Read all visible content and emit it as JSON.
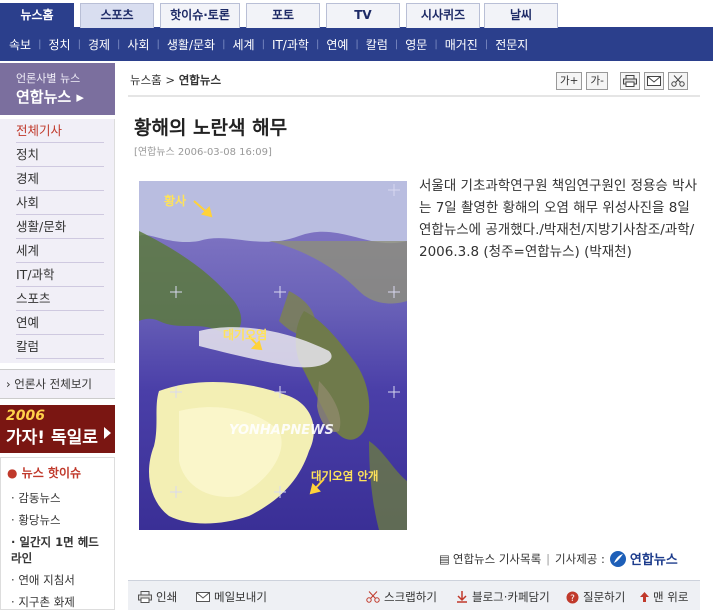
{
  "top_tabs": [
    "뉴스홈",
    "스포츠",
    "핫이슈·토론",
    "포토",
    "TV",
    "시사퀴즈",
    "날씨"
  ],
  "categories": [
    "속보",
    "정치",
    "경제",
    "사회",
    "생활/문화",
    "세계",
    "IT/과학",
    "연예",
    "칼럼",
    "영문",
    "매거진",
    "전문지"
  ],
  "sidebar": {
    "press_small": "언론사별 뉴스",
    "press_name": "연합뉴스",
    "items": [
      "전체기사",
      "정치",
      "경제",
      "사회",
      "생활/문화",
      "세계",
      "IT/과학",
      "스포츠",
      "연예",
      "칼럼"
    ],
    "all_press": "언론사 전체보기",
    "banner_year": "2006",
    "banner_text": "가자! 독일로",
    "issue_title": "뉴스 핫이슈",
    "issue_items": [
      "감동뉴스",
      "황당뉴스",
      "일간지 1면 헤드라인",
      "연애 지침서",
      "지구촌 화제"
    ]
  },
  "breadcrumb": {
    "home": "뉴스홈",
    "sep": ">",
    "current": "연합뉴스"
  },
  "toolbar": {
    "font_up": "가+",
    "font_down": "가-"
  },
  "article": {
    "title": "황해의 노란색 해무",
    "meta": "[연합뉴스 2006-03-08 16:09]",
    "body": "서울대 기초과학연구원 책임연구원인 정용승 박사는 7일 촬영한 황해의 오염 해무 위성사진을 8일 연합뉴스에 공개했다./박재천/지방기사참조/과학/ 2006.3.8 (청주=연합뉴스) (박재천)",
    "photo_labels": [
      "황사",
      "대기오염",
      "대기오염 안개"
    ],
    "watermark": "YONHAPNEWS"
  },
  "source": {
    "list": "연합뉴스 기사목록",
    "provider": "기사제공 :",
    "logo_text": "연합뉴스"
  },
  "footer_actions": [
    "인쇄",
    "메일보내기",
    "스크랩하기",
    "블로그·카페담기",
    "질문하기",
    "맨 위로"
  ]
}
